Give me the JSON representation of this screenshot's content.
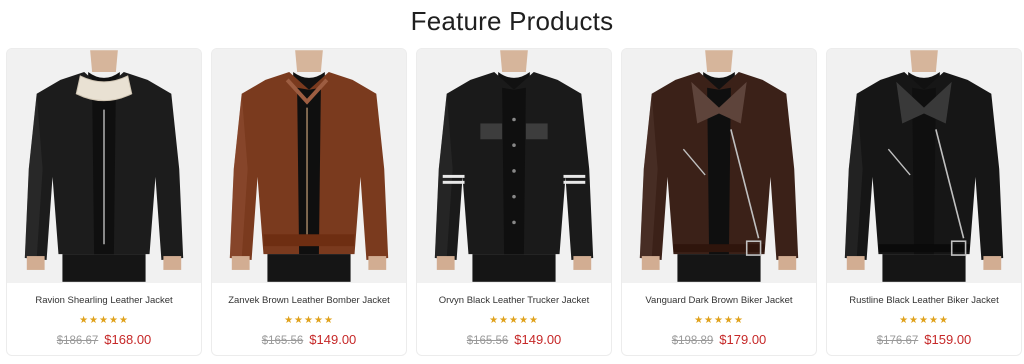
{
  "section": {
    "title": "Feature Products"
  },
  "colors": {
    "star": "#e0a21c",
    "sale_price": "#c62828",
    "old_price": "#9a9a9a"
  },
  "products": [
    {
      "name": "Ravion Shearling Leather Jacket",
      "rating_stars": "★★★★★",
      "old_price": "$186.67",
      "price": "$168.00",
      "jacket_color": "#1c1c1c",
      "variant": "shearling"
    },
    {
      "name": "Zanvek Brown Leather Bomber Jacket",
      "rating_stars": "★★★★★",
      "old_price": "$165.56",
      "price": "$149.00",
      "jacket_color": "#7a3a1e",
      "variant": "bomber"
    },
    {
      "name": "Orvyn Black Leather Trucker Jacket",
      "rating_stars": "★★★★★",
      "old_price": "$165.56",
      "price": "$149.00",
      "jacket_color": "#1a1a1a",
      "variant": "trucker"
    },
    {
      "name": "Vanguard Dark Brown Biker Jacket",
      "rating_stars": "★★★★★",
      "old_price": "$198.89",
      "price": "$179.00",
      "jacket_color": "#3b2118",
      "variant": "biker"
    },
    {
      "name": "Rustline Black Leather Biker Jacket",
      "rating_stars": "★★★★★",
      "old_price": "$176.67",
      "price": "$159.00",
      "jacket_color": "#161616",
      "variant": "biker"
    }
  ]
}
